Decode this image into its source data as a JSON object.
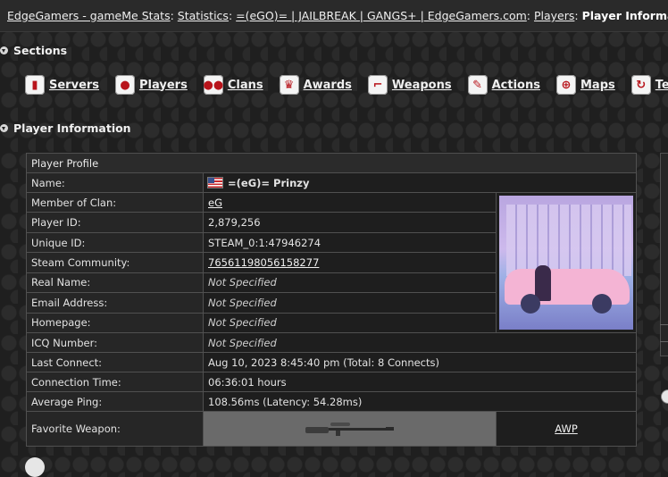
{
  "breadcrumb": {
    "items": [
      "EdgeGamers - gameMe Stats",
      "Statistics",
      "=(eGO)= | JAILBREAK | GANGS+ | EdgeGamers.com",
      "Players"
    ],
    "current": "Player Information"
  },
  "sections": {
    "title": "Sections",
    "nav": [
      {
        "label": "Servers",
        "icon": "server-icon"
      },
      {
        "label": "Players",
        "icon": "player-icon"
      },
      {
        "label": "Clans",
        "icon": "clan-icon"
      },
      {
        "label": "Awards",
        "icon": "trophy-icon"
      },
      {
        "label": "Weapons",
        "icon": "gun-icon"
      },
      {
        "label": "Actions",
        "icon": "wrench-icon"
      },
      {
        "label": "Maps",
        "icon": "target-icon"
      },
      {
        "label": "Teams",
        "icon": "refresh-icon"
      }
    ]
  },
  "player_info": {
    "title": "Player Information",
    "profile_header": "Player Profile",
    "rows": {
      "name": {
        "label": "Name:",
        "value": "=(eG)= Prinzy"
      },
      "clan": {
        "label": "Member of Clan:",
        "value": "eG"
      },
      "player_id": {
        "label": "Player ID:",
        "value": "2,879,256"
      },
      "unique_id": {
        "label": "Unique ID:",
        "value": "STEAM_0:1:47946274"
      },
      "steam": {
        "label": "Steam Community:",
        "value": "76561198056158277"
      },
      "real_name": {
        "label": "Real Name:",
        "value": "Not Specified"
      },
      "email": {
        "label": "Email Address:",
        "value": "Not Specified"
      },
      "homepage": {
        "label": "Homepage:",
        "value": "Not Specified"
      },
      "icq": {
        "label": "ICQ Number:",
        "value": "Not Specified"
      },
      "last_connect": {
        "label": "Last Connect:",
        "value": "Aug 10, 2023 8:45:40 pm (Total: 8 Connects)"
      },
      "connection_time": {
        "label": "Connection Time:",
        "value": "06:36:01 hours"
      },
      "avg_ping": {
        "label": "Average Ping:",
        "value": "108.56ms (Latency: 54.28ms)"
      },
      "fav_weapon": {
        "label": "Favorite Weapon:",
        "value": "AWP"
      }
    }
  }
}
